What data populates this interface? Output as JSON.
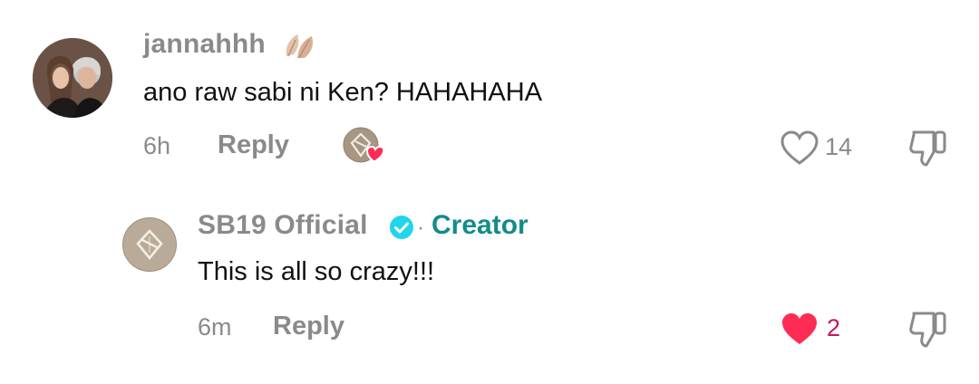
{
  "comments": [
    {
      "username": "jannahhh",
      "text": "ano raw sabi ni Ken? HAHAHAHA",
      "time": "6h",
      "reply_label": "Reply",
      "likes": "14",
      "liked": false
    },
    {
      "username": "SB19 Official",
      "badge": "Creator",
      "text": "This is all so crazy!!!",
      "time": "6m",
      "reply_label": "Reply",
      "likes": "2",
      "liked": true
    }
  ],
  "icons": {
    "leaf": "autumn-leaf-icon",
    "heart_outline": "heart-outline-icon",
    "heart_filled": "heart-filled-icon",
    "dislike": "thumbs-down-icon",
    "verified": "verified-check-icon",
    "creator_liked": "creator-liked-badge-icon"
  },
  "colors": {
    "like_red": "#fe2c55",
    "creator_teal": "#148b8b",
    "verified_blue": "#20d5ec"
  }
}
